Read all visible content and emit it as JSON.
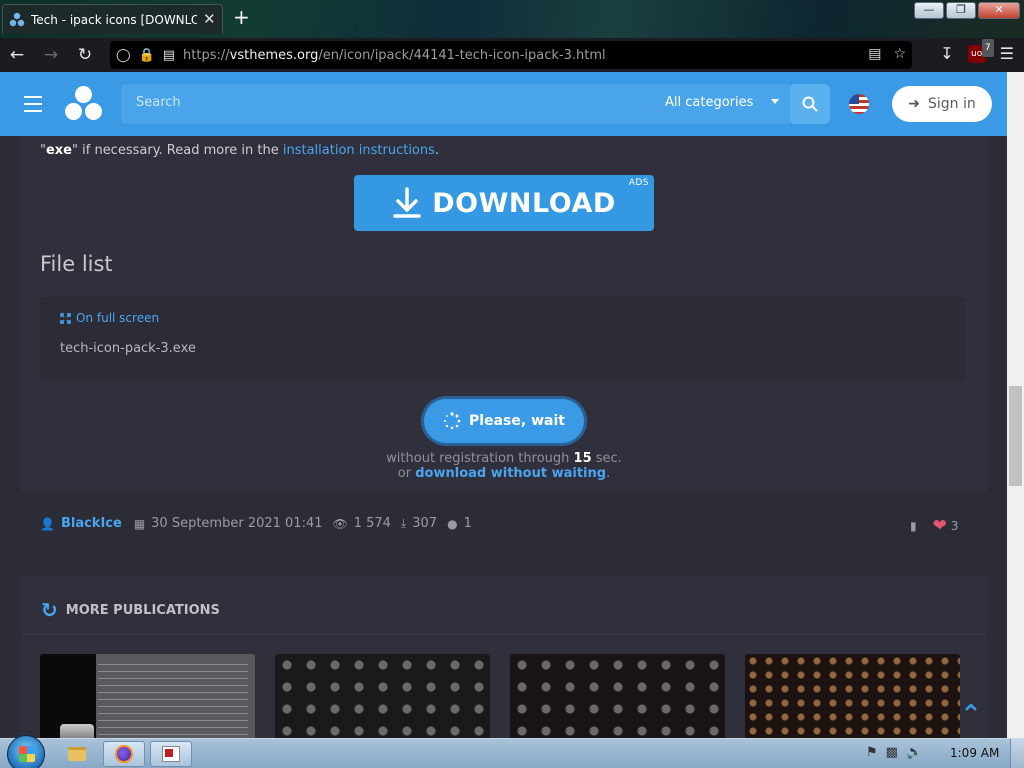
{
  "browser": {
    "tab_title": "Tech - ipack icons [DOWNLOAD",
    "tab_close": "✕",
    "new_tab": "+",
    "url_host": "vsthemes.org",
    "url_prefix": "https://",
    "url_path": "/en/icon/ipack/44141-tech-icon-ipack-3.html",
    "extension_badge": "7",
    "extension_label": "uo",
    "window_buttons": [
      "—",
      "❐",
      "✕"
    ]
  },
  "site": {
    "search_placeholder": "Search",
    "category_select": "All categories",
    "signin_label": "Sign in"
  },
  "content": {
    "intro_prefix": "\"",
    "intro_bold": "exe",
    "intro_mid": "\" if necessary. Read more in the ",
    "intro_link": "installation instructions",
    "intro_end": ".",
    "download_label": "DOWNLOAD",
    "ads_label": "ADS",
    "file_list_heading": "File list",
    "fullscreen_label": "On full screen",
    "file_name": "tech-icon-pack-3.exe",
    "wait_button": "Please, wait",
    "wait_text_before": "without registration through ",
    "wait_seconds": "15",
    "wait_text_after": " sec.",
    "or_text": "or ",
    "download_without_waiting": "download without waiting",
    "period": "."
  },
  "meta": {
    "author": "BlackIce",
    "date": "30 September 2021 01:41",
    "views": "1 574",
    "downloads": "307",
    "comments": "1",
    "likes": "3"
  },
  "publications": {
    "heading": "MORE PUBLICATIONS"
  },
  "taskbar": {
    "clock": "1:09 AM"
  },
  "colors": {
    "accent": "#3b9ae5",
    "link": "#4aa5f0",
    "page_bg": "#2b2c36",
    "card_bg": "#2f303b",
    "heart": "#e05570"
  },
  "icons": [
    "hamburger-icon",
    "logo-icon",
    "search-icon",
    "flag-us-icon",
    "sign-in-icon",
    "download-arrow-icon",
    "fullscreen-icon",
    "spinner-icon",
    "user-icon",
    "calendar-icon",
    "eye-icon",
    "download-icon",
    "comment-icon",
    "bookmark-icon",
    "heart-icon",
    "refresh-icon",
    "chevron-up-icon"
  ]
}
